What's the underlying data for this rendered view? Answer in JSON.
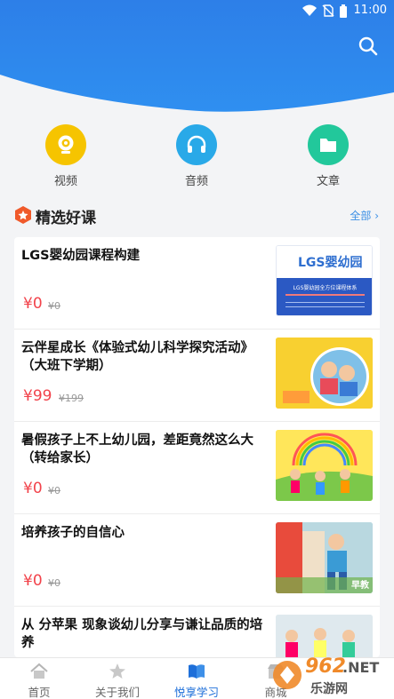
{
  "status_bar": {
    "time": "11:00"
  },
  "categories": [
    {
      "label": "视频",
      "icon": "video-camera-icon",
      "color": "#f6c400"
    },
    {
      "label": "音频",
      "icon": "headphones-icon",
      "color": "#29a9e8"
    },
    {
      "label": "文章",
      "icon": "folder-icon",
      "color": "#22c89b"
    }
  ],
  "section": {
    "title": "精选好课",
    "more": "全部 ›"
  },
  "courses": [
    {
      "title": "LGS婴幼园课程构建",
      "price": "¥0",
      "old_price": "¥0",
      "thumb_title": "LGS婴幼园",
      "thumb_sub": "LGS婴幼园全方位课程体系"
    },
    {
      "title": "云伴星成长《体验式幼儿科学探究活动》（大班下学期）",
      "price": "¥99",
      "old_price": "¥199"
    },
    {
      "title": "暑假孩子上不上幼儿园，差距竟然这么大（转给家长）",
      "price": "¥0",
      "old_price": "¥0"
    },
    {
      "title": "培养孩子的自信心",
      "price": "¥0",
      "old_price": "¥0",
      "thumb_sub": "早教"
    },
    {
      "title": "从 分苹果 现象谈幼儿分享与谦让品质的培养",
      "price": "",
      "old_price": ""
    }
  ],
  "tabbar": [
    {
      "label": "首页",
      "icon": "home-icon"
    },
    {
      "label": "关于我们",
      "icon": "star-person-icon"
    },
    {
      "label": "悦享学习",
      "icon": "book-icon",
      "active": true
    },
    {
      "label": "商城",
      "icon": "shop-icon"
    }
  ],
  "watermark": {
    "text1": "962",
    "text2": ".NET",
    "text3": "乐游网"
  },
  "colors": {
    "header_blue": "#2b83e6",
    "price_red": "#f2434b",
    "active_tab": "#1e6fd9"
  }
}
